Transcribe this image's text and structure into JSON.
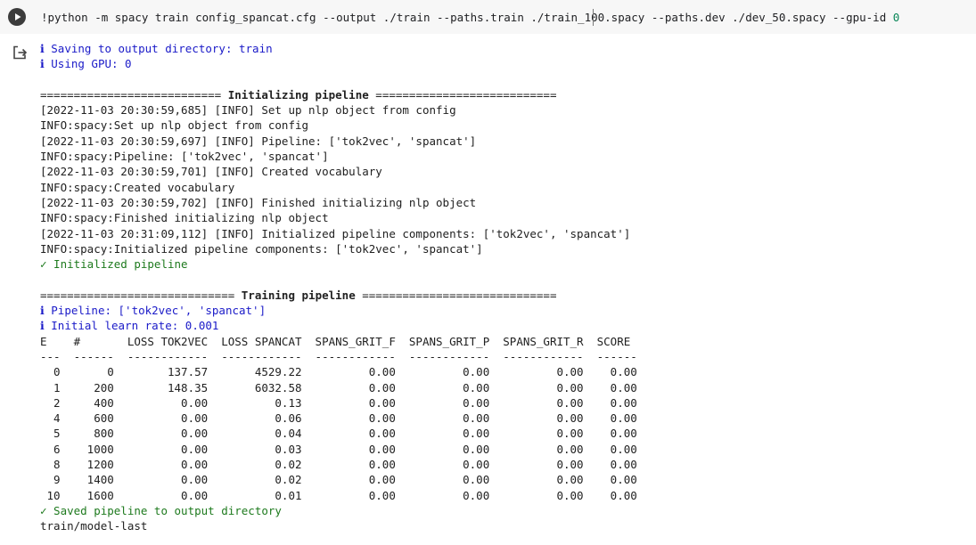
{
  "input": {
    "command_prefix": "!python -m spacy train config_spancat.cfg --output ./train --paths.train ./train_100.spacy --paths.dev ./dev_50.spacy --gpu-id ",
    "command_gpu": "0"
  },
  "output": {
    "saving_msg": "ℹ Saving to output directory: train",
    "gpu_msg": "ℹ Using GPU: 0",
    "init_header_left": "=========================== ",
    "init_header_title": "Initializing pipeline",
    "init_header_right": " ===========================",
    "init_lines": [
      "[2022-11-03 20:30:59,685] [INFO] Set up nlp object from config",
      "INFO:spacy:Set up nlp object from config",
      "[2022-11-03 20:30:59,697] [INFO] Pipeline: ['tok2vec', 'spancat']",
      "INFO:spacy:Pipeline: ['tok2vec', 'spancat']",
      "[2022-11-03 20:30:59,701] [INFO] Created vocabulary",
      "INFO:spacy:Created vocabulary",
      "[2022-11-03 20:30:59,702] [INFO] Finished initializing nlp object",
      "INFO:spacy:Finished initializing nlp object",
      "[2022-11-03 20:31:09,112] [INFO] Initialized pipeline components: ['tok2vec', 'spancat']",
      "INFO:spacy:Initialized pipeline components: ['tok2vec', 'spancat']"
    ],
    "init_done": "✓ Initialized pipeline",
    "train_header_left": "============================= ",
    "train_header_title": "Training pipeline",
    "train_header_right": " =============================",
    "pipeline_msg": "ℹ Pipeline: ['tok2vec', 'spancat']",
    "lr_msg": "ℹ Initial learn rate: 0.001",
    "table_header": "E    #       LOSS TOK2VEC  LOSS SPANCAT  SPANS_GRIT_F  SPANS_GRIT_P  SPANS_GRIT_R  SCORE ",
    "table_sep": "---  ------  ------------  ------------  ------------  ------------  ------------  ------",
    "table_rows": [
      "  0       0        137.57       4529.22          0.00          0.00          0.00    0.00",
      "  1     200        148.35       6032.58          0.00          0.00          0.00    0.00",
      "  2     400          0.00          0.13          0.00          0.00          0.00    0.00",
      "  4     600          0.00          0.06          0.00          0.00          0.00    0.00",
      "  5     800          0.00          0.04          0.00          0.00          0.00    0.00",
      "  6    1000          0.00          0.03          0.00          0.00          0.00    0.00",
      "  8    1200          0.00          0.02          0.00          0.00          0.00    0.00",
      "  9    1400          0.00          0.02          0.00          0.00          0.00    0.00",
      " 10    1600          0.00          0.01          0.00          0.00          0.00    0.00"
    ],
    "saved_msg": "✓ Saved pipeline to output directory",
    "model_path": "train/model-last"
  }
}
